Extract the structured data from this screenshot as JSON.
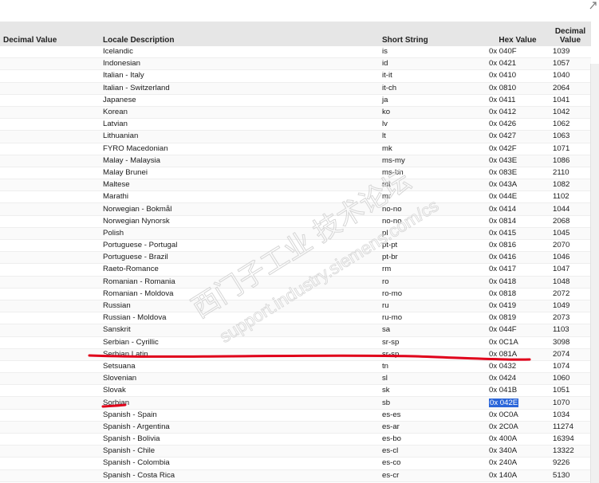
{
  "headers": {
    "decimal_value": "Decimal Value",
    "locale_description": "Locale Description",
    "short_string": "Short String",
    "hex_value": "Hex Value",
    "decimal_value_right_line1": "Decimal",
    "decimal_value_right_line2": "Value"
  },
  "rows": [
    {
      "desc": "Icelandic",
      "short": "is",
      "hex": "0x 040F",
      "dec": "1039"
    },
    {
      "desc": "Indonesian",
      "short": "id",
      "hex": "0x 0421",
      "dec": "1057"
    },
    {
      "desc": "Italian - Italy",
      "short": "it-it",
      "hex": "0x 0410",
      "dec": "1040"
    },
    {
      "desc": "Italian - Switzerland",
      "short": "it-ch",
      "hex": "0x 0810",
      "dec": "2064"
    },
    {
      "desc": "Japanese",
      "short": "ja",
      "hex": "0x 0411",
      "dec": "1041"
    },
    {
      "desc": "Korean",
      "short": "ko",
      "hex": "0x 0412",
      "dec": "1042"
    },
    {
      "desc": "Latvian",
      "short": "lv",
      "hex": "0x 0426",
      "dec": "1062"
    },
    {
      "desc": "Lithuanian",
      "short": "lt",
      "hex": "0x 0427",
      "dec": "1063"
    },
    {
      "desc": "FYRO Macedonian",
      "short": "mk",
      "hex": "0x 042F",
      "dec": "1071"
    },
    {
      "desc": "Malay - Malaysia",
      "short": "ms-my",
      "hex": "0x 043E",
      "dec": "1086"
    },
    {
      "desc": "Malay Brunei",
      "short": "ms-bn",
      "hex": "0x 083E",
      "dec": "2110"
    },
    {
      "desc": "Maltese",
      "short": "mt",
      "hex": "0x 043A",
      "dec": "1082"
    },
    {
      "desc": "Marathi",
      "short": "mr",
      "hex": "0x 044E",
      "dec": "1102"
    },
    {
      "desc": "Norwegian - Bokmål",
      "short": "no-no",
      "hex": "0x 0414",
      "dec": "1044"
    },
    {
      "desc": "Norwegian Nynorsk",
      "short": "no-no",
      "hex": "0x 0814",
      "dec": "2068"
    },
    {
      "desc": "Polish",
      "short": "pl",
      "hex": "0x 0415",
      "dec": "1045"
    },
    {
      "desc": "Portuguese - Portugal",
      "short": "pt-pt",
      "hex": "0x 0816",
      "dec": "2070"
    },
    {
      "desc": "Portuguese - Brazil",
      "short": "pt-br",
      "hex": "0x 0416",
      "dec": "1046"
    },
    {
      "desc": "Raeto-Romance",
      "short": "rm",
      "hex": "0x 0417",
      "dec": "1047"
    },
    {
      "desc": "Romanian - Romania",
      "short": "ro",
      "hex": "0x 0418",
      "dec": "1048"
    },
    {
      "desc": "Romanian - Moldova",
      "short": "ro-mo",
      "hex": "0x 0818",
      "dec": "2072"
    },
    {
      "desc": "Russian",
      "short": "ru",
      "hex": "0x 0419",
      "dec": "1049"
    },
    {
      "desc": "Russian - Moldova",
      "short": "ru-mo",
      "hex": "0x 0819",
      "dec": "2073"
    },
    {
      "desc": "Sanskrit",
      "short": "sa",
      "hex": "0x 044F",
      "dec": "1103"
    },
    {
      "desc": "Serbian - Cyrillic",
      "short": "sr-sp",
      "hex": "0x 0C1A",
      "dec": "3098"
    },
    {
      "desc": "Serbian Latin",
      "short": "sr-sp",
      "hex": "0x 081A",
      "dec": "2074"
    },
    {
      "desc": "Setsuana",
      "short": "tn",
      "hex": "0x 0432",
      "dec": "1074"
    },
    {
      "desc": "Slovenian",
      "short": "sl",
      "hex": "0x 0424",
      "dec": "1060"
    },
    {
      "desc": "Slovak",
      "short": "sk",
      "hex": "0x 041B",
      "dec": "1051"
    },
    {
      "desc": "Sorbian",
      "short": "sb",
      "hex": "0x 042E",
      "dec": "1070",
      "selected_hex": true
    },
    {
      "desc": "Spanish - Spain",
      "short": "es-es",
      "hex": "0x 0C0A",
      "dec": "1034"
    },
    {
      "desc": "Spanish - Argentina",
      "short": "es-ar",
      "hex": "0x 2C0A",
      "dec": "11274"
    },
    {
      "desc": "Spanish - Bolivia",
      "short": "es-bo",
      "hex": "0x 400A",
      "dec": "16394"
    },
    {
      "desc": "Spanish - Chile",
      "short": "es-cl",
      "hex": "0x 340A",
      "dec": "13322"
    },
    {
      "desc": "Spanish - Colombia",
      "short": "es-co",
      "hex": "0x 240A",
      "dec": "9226"
    },
    {
      "desc": "Spanish - Costa Rica",
      "short": "es-cr",
      "hex": "0x 140A",
      "dec": "5130"
    }
  ],
  "watermark": {
    "line1": "西门子工业  技术论坛",
    "line2": "support.industry.siemens.com/cs"
  },
  "colors": {
    "header_bg": "#e6e6e6",
    "selection": "#2b66d9",
    "annotation_red": "#e0001a",
    "watermark": "#d6d6d6"
  },
  "icons": {
    "corner": "resize-arrow-icon"
  }
}
